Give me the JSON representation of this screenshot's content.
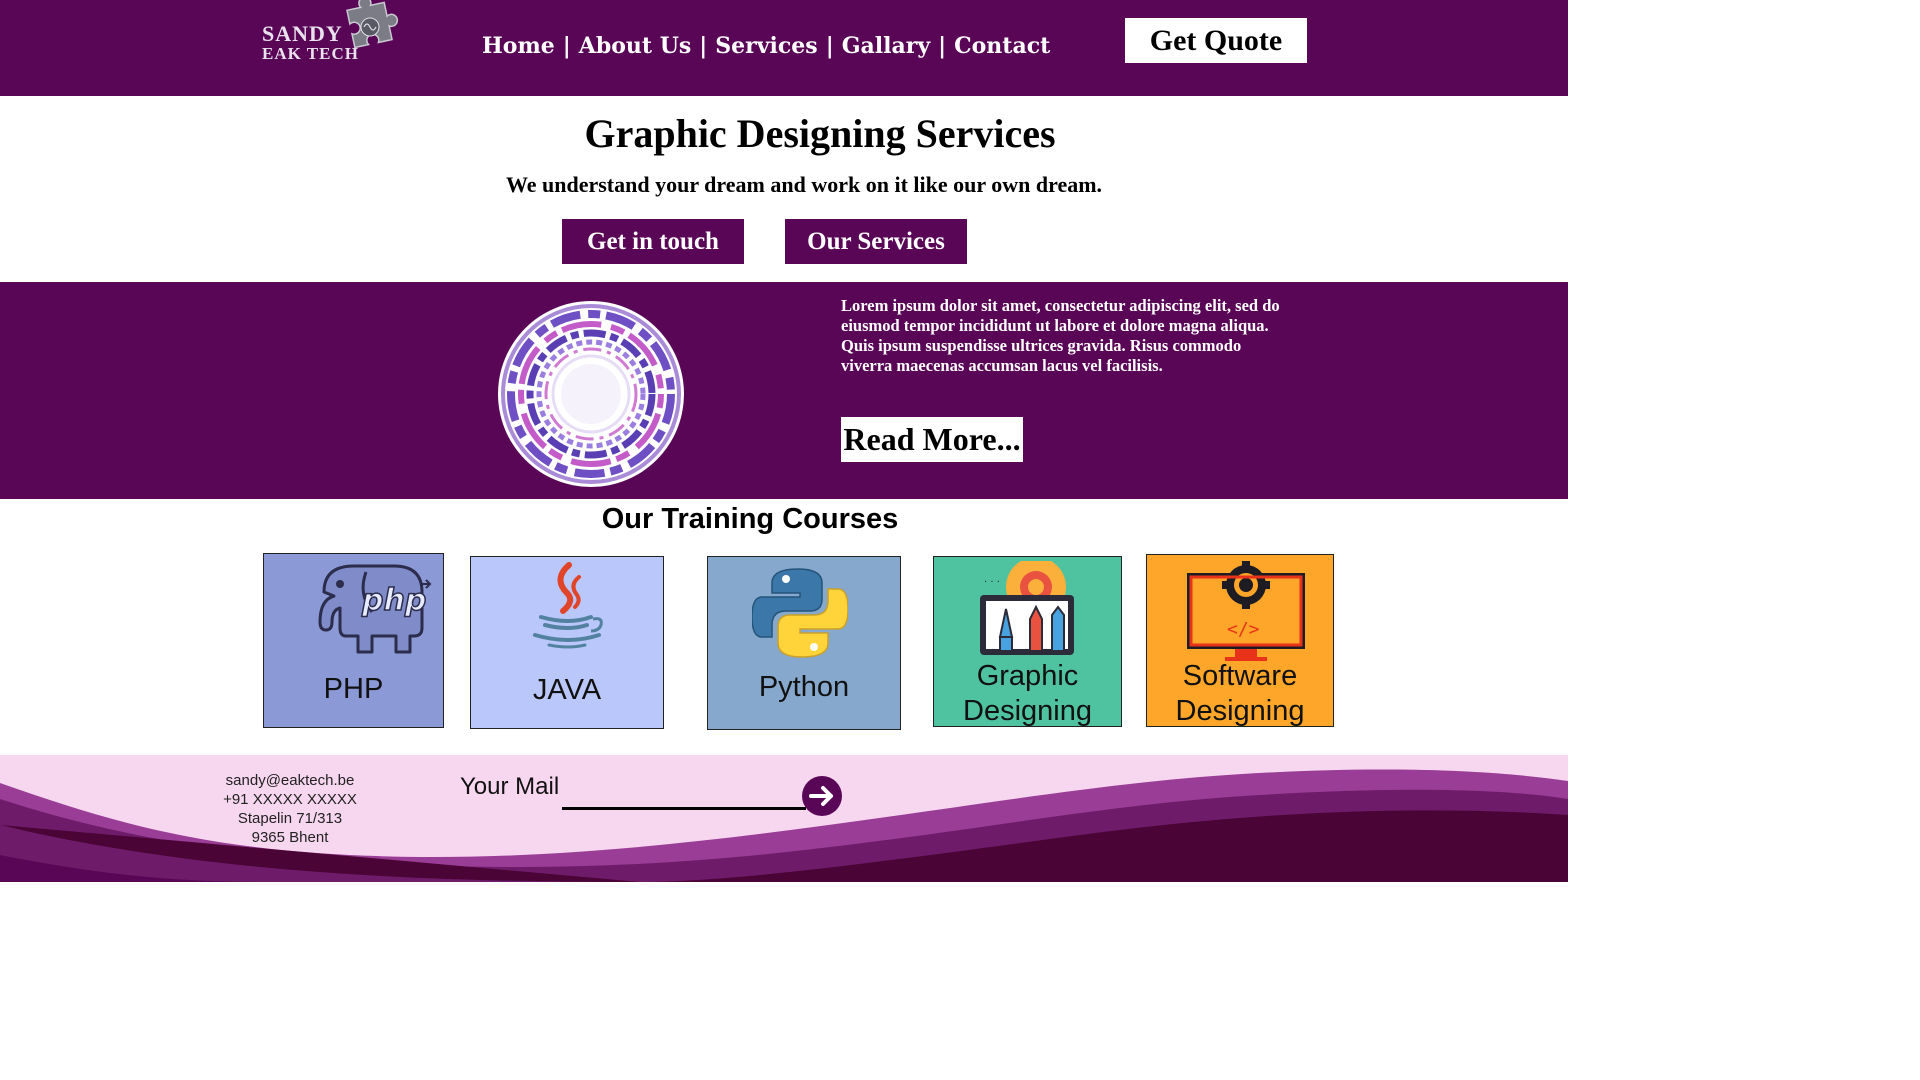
{
  "header": {
    "logo": {
      "line1": "SANDY",
      "line2": "EAK TECH"
    },
    "nav": [
      {
        "label": "Home"
      },
      {
        "label": "About Us"
      },
      {
        "label": "Services"
      },
      {
        "label": "Gallary"
      },
      {
        "label": "Contact"
      }
    ],
    "nav_separator": "|",
    "quote_button": "Get Quote"
  },
  "hero": {
    "title": "Graphic Designing Services",
    "subtitle": "We understand your dream and work on it like our own dream.",
    "buttons": [
      "Get in touch",
      "Our Services"
    ]
  },
  "feature": {
    "text": "Lorem ipsum dolor sit amet, consectetur adipiscing elit, sed do eiusmod tempor incididunt ut labore et dolore magna aliqua. Quis ipsum suspendisse ultrices gravida. Risus commodo viverra maecenas accumsan lacus vel facilisis.",
    "read_more": "Read More..."
  },
  "courses": {
    "title": "Our Training Courses",
    "items": [
      {
        "label": "PHP",
        "icon": "php-elephant-icon",
        "color": "#8b9ad6"
      },
      {
        "label": "JAVA",
        "icon": "java-cup-icon",
        "color": "#b9c7fa"
      },
      {
        "label": "Python",
        "icon": "python-icon",
        "color": "#85a8cc"
      },
      {
        "label_line1": "Graphic",
        "label_line2": "Designing",
        "icon": "graphic-design-icon",
        "color": "#4fc29f"
      },
      {
        "label_line1": "Software",
        "label_line2": "Designing",
        "icon": "software-monitor-icon",
        "color": "#fea62a"
      }
    ]
  },
  "footer": {
    "email": "sandy@eaktech.be",
    "phone": "+91 XXXXX XXXXX",
    "address1": "Stapelin 71/313",
    "address2": "9365 Bhent",
    "mail_label": "Your Mail",
    "mail_placeholder": ""
  },
  "colors": {
    "brand": "#5a0657",
    "footer_light": "#f7d7ef",
    "footer_dark": "#4a0436"
  }
}
